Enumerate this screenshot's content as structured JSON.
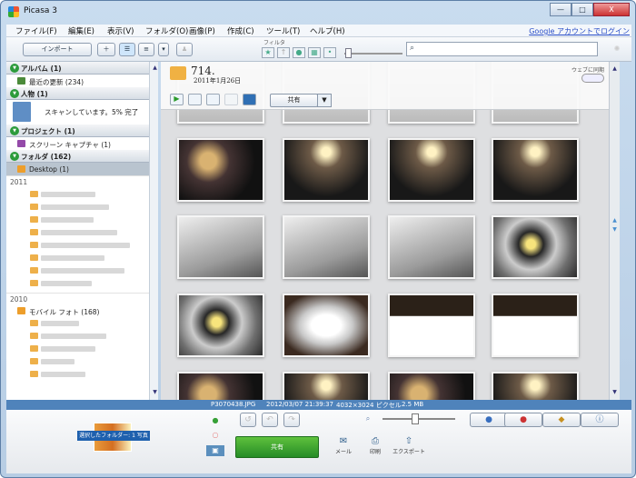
{
  "window": {
    "title": "Picasa 3",
    "min": "—",
    "max": "□",
    "close": "X"
  },
  "menu": [
    "ファイル(F)",
    "編集(E)",
    "表示(V)",
    "フォルダ(O)",
    "画像(P)",
    "作成(C)",
    "ツール(T)",
    "ヘルプ(H)"
  ],
  "login": "Google アカウントでログイン",
  "toolbar": {
    "import": "インポート",
    "filter_label": "フィルタ",
    "filter_icons": [
      "star-icon",
      "upload-icon",
      "person-icon",
      "grid-icon",
      "pin-icon"
    ]
  },
  "sidebar": {
    "sections": [
      {
        "label": "アルバム (1)",
        "items": [
          {
            "label": "最近の更新 (234)"
          }
        ]
      },
      {
        "label": "人物 (1)",
        "items": [
          {
            "label": "スキャンしています。5% 完了"
          }
        ]
      },
      {
        "label": "プロジェクト (1)",
        "items": [
          {
            "label": "スクリーン キャプチャ (1)"
          }
        ]
      },
      {
        "label": "フォルダ (162)",
        "items": [
          {
            "label": "Desktop (1)",
            "selected": true
          }
        ]
      }
    ],
    "years": [
      "2011",
      "2010"
    ],
    "mobile_folder": "モバイル フォト (168)"
  },
  "album": {
    "title": "714.",
    "date": "2011年1月26日",
    "share": "共有",
    "web_sync": "ウェブに同期"
  },
  "status": {
    "filename": "P3070438.JPG",
    "datetime": "2012/03/07 21:39:37",
    "dimensions": "4032×3024 ピクセル",
    "size": "2.5 MB"
  },
  "bottom": {
    "tray_label": "選択したフォルダー: 1 写真",
    "share": "共有",
    "mail": "メール",
    "print": "印刷",
    "export": "エクスポート"
  }
}
